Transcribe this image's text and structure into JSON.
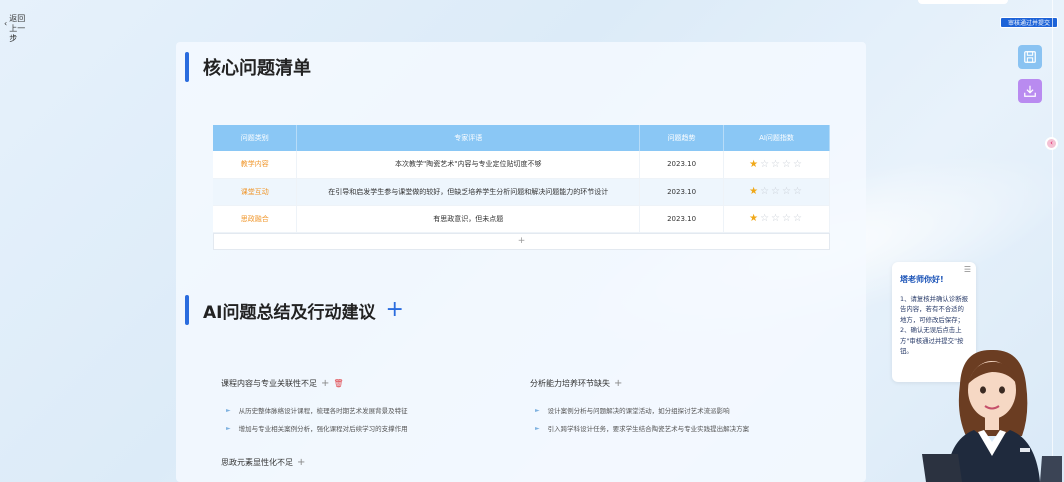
{
  "nav": {
    "back_label": "返回上一步",
    "approve_label": "审核通过并提交"
  },
  "icons": {
    "save": "save-icon",
    "download": "download-icon",
    "slider": "slider-handle-icon",
    "menu": "menu-icon"
  },
  "colors": {
    "accent": "#2a6cde",
    "header": "#8ac7f5",
    "category": "#f0962a",
    "star": "#f0a818",
    "approve": "#1d63d8"
  },
  "section1": {
    "title": "核心问题清单",
    "headers": [
      "问题类别",
      "专家评语",
      "问题趋势",
      "AI问题指数"
    ],
    "rows": [
      {
        "category": "教学内容",
        "comment": "本次教学\"陶瓷艺术\"内容与专业定位贴切度不够",
        "date": "2023.10",
        "rating": 1
      },
      {
        "category": "课堂互动",
        "comment": "在引导和启发学生参与课堂做的较好，但缺乏培养学生分析问题和解决问题能力的环节设计",
        "date": "2023.10",
        "rating": 1
      },
      {
        "category": "思政融合",
        "comment": "有思政意识，但未点题",
        "date": "2023.10",
        "rating": 1
      }
    ],
    "max_rating": 5,
    "add_symbol": "+"
  },
  "section2": {
    "title": "AI问题总结及行动建议",
    "add_symbol": "+",
    "groups": [
      {
        "title": "课程内容与专业关联性不足",
        "items": [
          "从历史整体脉络设计课程，梳理各时期艺术发展背景及特征",
          "增加与专业相关案例分析，强化课程对后续学习的支撑作用"
        ]
      },
      {
        "title": "分析能力培养环节缺失",
        "items": [
          "设计案例分析与问题解决的课堂活动，如分组探讨艺术流派影响",
          "引入跨学科设计任务，要求学生结合陶瓷艺术与专业实践提出解决方案"
        ]
      },
      {
        "title": "思政元素显性化不足",
        "items": []
      }
    ]
  },
  "assistant": {
    "greeting": "塔老师你好!",
    "message": "1、请复核并确认诊断报告内容，若有不合适的地方，可修改后保存；2、确认无误后点击上方\"审核通过并提交\"按钮。"
  }
}
